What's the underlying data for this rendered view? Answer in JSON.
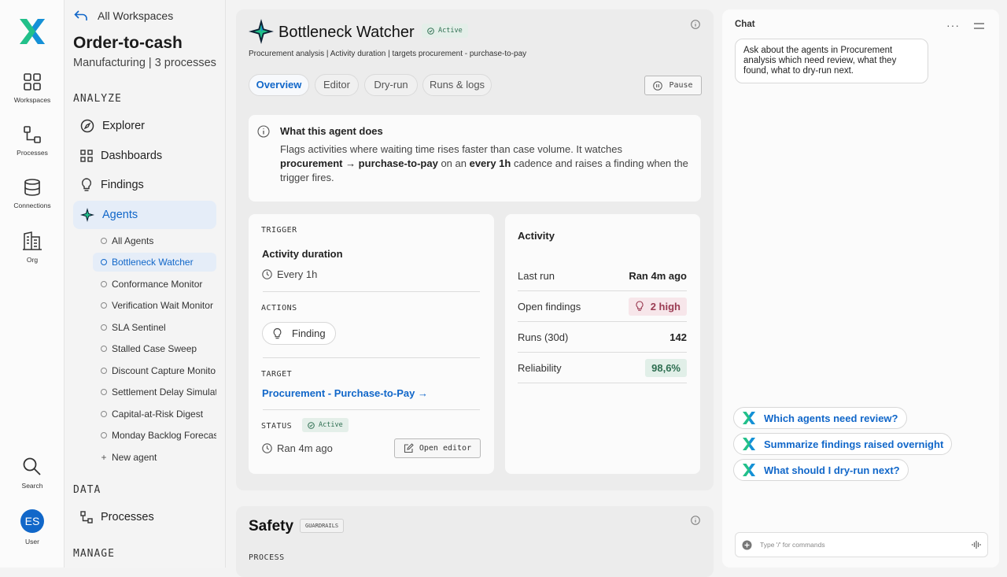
{
  "rail": {
    "items": [
      {
        "label": "Workspaces",
        "icon": "grid-icon"
      },
      {
        "label": "Processes",
        "icon": "process-icon"
      },
      {
        "label": "Connections",
        "icon": "database-icon"
      },
      {
        "label": "Org",
        "icon": "building-icon"
      }
    ],
    "search_label": "Search",
    "user_label": "User",
    "user_initials": "ES"
  },
  "nav": {
    "back_label": "All Workspaces",
    "title": "Order-to-cash",
    "subtitle": "Manufacturing | 3 processes",
    "analyze_header": "ANALYZE",
    "analyze_items": [
      "Explorer",
      "Dashboards",
      "Findings",
      "Agents"
    ],
    "agents": [
      "All Agents",
      "Bottleneck Watcher",
      "Conformance Monitor",
      "Verification Wait Monitor",
      "SLA Sentinel",
      "Stalled Case Sweep",
      "Discount Capture Monito",
      "Settlement Delay Simulat",
      "Capital-at-Risk Digest",
      "Monday Backlog Forecas"
    ],
    "new_agent": "New agent",
    "data_header": "DATA",
    "data_items": [
      "Processes"
    ],
    "manage_header": "MANAGE"
  },
  "agent": {
    "title": "Bottleneck Watcher",
    "status": "Active",
    "breadcrumb": "Procurement analysis | Activity duration | targets procurement - purchase-to-pay",
    "tabs": [
      "Overview",
      "Editor",
      "Dry-run",
      "Runs & logs"
    ],
    "pause_label": "Pause"
  },
  "about": {
    "heading": "What this agent does",
    "t1": "Flags activities where waiting time rises faster than case volume. It watches",
    "b1": "procurement → purchase-to-pay",
    "t2": " on an ",
    "b2": "every 1h",
    "t3": " cadence and raises a finding when the",
    "t4": "trigger fires."
  },
  "config": {
    "trigger_label": "TRIGGER",
    "trigger_value": "Activity duration",
    "trigger_schedule": "Every 1h",
    "actions_label": "ACTIONS",
    "action_chip": "Finding",
    "target_label": "TARGET",
    "target_link": "Procurement - Purchase-to-Pay →",
    "status_label": "STATUS",
    "status_badge": "Active",
    "status_time": "Ran 4m ago",
    "open_editor": "Open editor"
  },
  "activity": {
    "heading": "Activity",
    "rows": [
      {
        "label": "Last run",
        "value": "Ran 4m ago"
      },
      {
        "label": "Open findings",
        "value": "2 high"
      },
      {
        "label": "Runs (30d)",
        "value": "142"
      },
      {
        "label": "Reliability",
        "value": "98,6%"
      }
    ]
  },
  "safety": {
    "title": "Safety",
    "badge": "GUARDRAILS",
    "process_label": "PROCESS"
  },
  "chat": {
    "title": "Chat",
    "message": "Ask about the agents in Procurement analysis which need review, what they found, what to dry-run next.",
    "suggestions": [
      "Which agents need review?",
      "Summarize findings raised overnight",
      "What should I dry-run next?"
    ],
    "placeholder": "Type '/' for commands"
  },
  "colors": {
    "accent": "#1167c9",
    "brand_green": "#22c08a",
    "brand_blue": "#1590d8",
    "danger_bg": "#f7e6ea",
    "success_bg": "#e4efe9"
  }
}
